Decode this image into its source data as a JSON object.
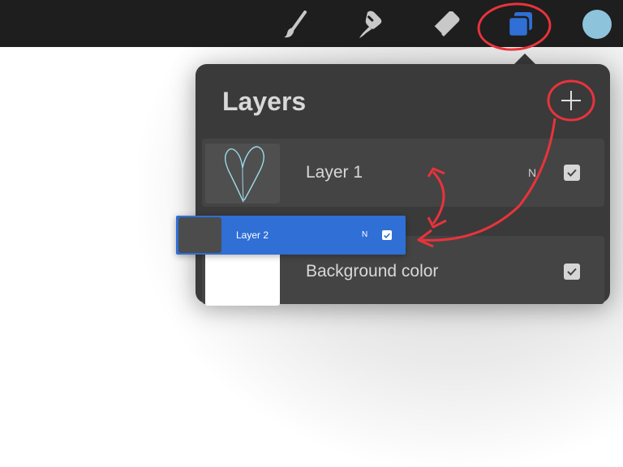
{
  "toolbar": {
    "tools": [
      {
        "icon": "brush-icon",
        "active": false
      },
      {
        "icon": "smudge-icon",
        "active": false
      },
      {
        "icon": "eraser-icon",
        "active": false
      },
      {
        "icon": "layers-icon",
        "active": true
      }
    ],
    "current_color": "#8ec3dc",
    "active_color": "#2f6fd6"
  },
  "layers_panel": {
    "title": "Layers",
    "add_icon": "plus-icon",
    "layers": [
      {
        "name": "Layer 1",
        "blend_mode": "N",
        "visible": true,
        "thumbnail": "heart-sketch"
      },
      {
        "name": "Background color",
        "blend_mode": "",
        "visible": true,
        "thumbnail_color": "#ffffff"
      }
    ]
  },
  "dragged_layer": {
    "name": "Layer 2",
    "blend_mode": "N",
    "visible": true,
    "highlight_color": "#2f6fd6"
  },
  "annotation": {
    "color": "#e8333c"
  }
}
